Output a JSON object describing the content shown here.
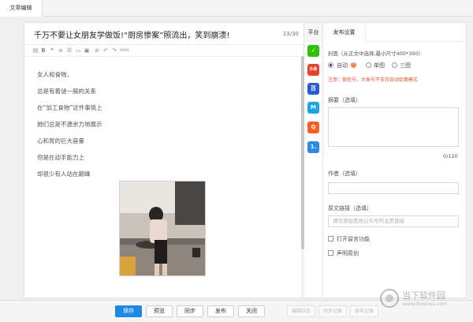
{
  "top_tab": {
    "label": "文章编辑"
  },
  "editor": {
    "title": "千万不要让女朋友学做饭!“厨房惨案”照流出，笑到崩溃!",
    "title_count": "23/30",
    "toolbar": {
      "icons": [
        "bold-icon",
        "quote-icon",
        "list-icon",
        "align-icon",
        "image-icon",
        "link-icon",
        "undo-icon",
        "redo-icon"
      ],
      "last_label": "html"
    },
    "paragraphs": [
      "女人和食物，",
      "总是有着谜一般的关系",
      "在“加工食物”这件事情上",
      "她们总是不遗余力地展示",
      "心和胃的巨大容量",
      "但是在动手能力上",
      "却很少有人站在巅峰"
    ]
  },
  "platform": {
    "label": "平台",
    "items": [
      {
        "name": "wechat-icon",
        "text": "✓",
        "color": "#2dc100"
      },
      {
        "name": "toutiao-icon",
        "text": "头条",
        "color": "#e8412c"
      },
      {
        "name": "baijia-icon",
        "text": "百",
        "color": "#2a5bd7"
      },
      {
        "name": "yidian-icon",
        "text": "M",
        "color": "#1aa6e8"
      },
      {
        "name": "qq-icon",
        "text": "Q",
        "color": "#ff5e1f"
      },
      {
        "name": "dayu-icon",
        "text": "1.",
        "color": "#2b8ce8"
      }
    ]
  },
  "settings": {
    "tab_label": "发布设置",
    "cover_label": "封面（从正文中选择,最小尺寸400*300）",
    "radio_auto": "自动",
    "radio_single": "单图",
    "radio_three": "三图",
    "warning": "注意：微信号，大鱼号不支持自动封面模式",
    "summary_label": "摘要（选填）",
    "summary_count": "0/120",
    "author_label": "作者（选填）",
    "source_label": "原文链接（选填）",
    "source_placeholder": "请勿添加其他公众号的主页链接",
    "check_comment": "打开留言功能",
    "check_original": "声明原创"
  },
  "bottom": {
    "save": "保存",
    "preview": "预览",
    "sync": "同步",
    "publish": "发布",
    "close": "关闭",
    "edit_status": "编辑状态",
    "sync_record": "同步记录",
    "publish_record": "发布记录"
  },
  "watermark": {
    "text": "当下软件园",
    "sub": "www.downxia.com"
  },
  "colors": {
    "primary": "#1e88e5",
    "warning": "#e8552e"
  }
}
